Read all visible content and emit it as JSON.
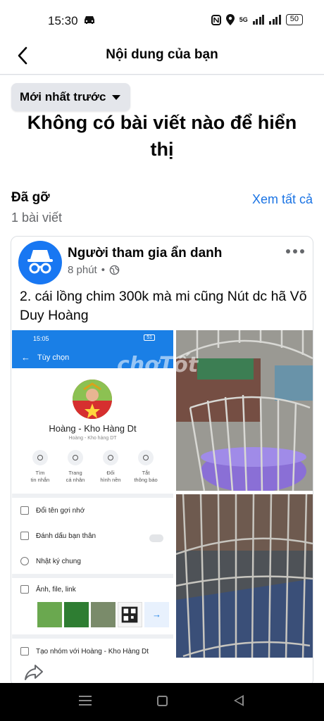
{
  "status_bar": {
    "time": "15:30",
    "network": "5G",
    "battery": "50"
  },
  "header": {
    "title": "Nội dung của bạn"
  },
  "empty_state": {
    "line1": "Không có bài viết nào để hiển",
    "line2": "thị"
  },
  "sort": {
    "label": "Mới nhất trước"
  },
  "section": {
    "title": "Đã gỡ",
    "see_all": "Xem tất cả",
    "count": "1 bài viết"
  },
  "post": {
    "author": "Người tham gia ẩn danh",
    "time": "8 phút",
    "separator": "•",
    "text": "2. cái lồng chim 300k mà mi cũng Nút dc hã Võ Duy Hoàng",
    "watermark": "chợTốt",
    "screenshot": {
      "time": "15:05",
      "battery": "51",
      "nav_title": "Tùy chọn",
      "profile_name": "Hoàng - Kho Hàng Dt",
      "profile_sub": "Hoàng - Kho hàng DT",
      "actions": [
        {
          "line1": "Tìm",
          "line2": "tin nhắn"
        },
        {
          "line1": "Trang",
          "line2": "cá nhân"
        },
        {
          "line1": "Đổi",
          "line2": "hình nền"
        },
        {
          "line1": "Tắt",
          "line2": "thông báo"
        }
      ],
      "rows": [
        "Đổi tên gợi nhớ",
        "Đánh dấu bạn thân",
        "Nhật ký chung",
        "Ảnh, file, link",
        "Tạo nhóm với Hoàng - Kho Hàng Dt"
      ]
    }
  },
  "colors": {
    "accent": "#1b74e4",
    "avatar_blue": "#1877f2",
    "chip_bg": "#e4e6eb"
  }
}
